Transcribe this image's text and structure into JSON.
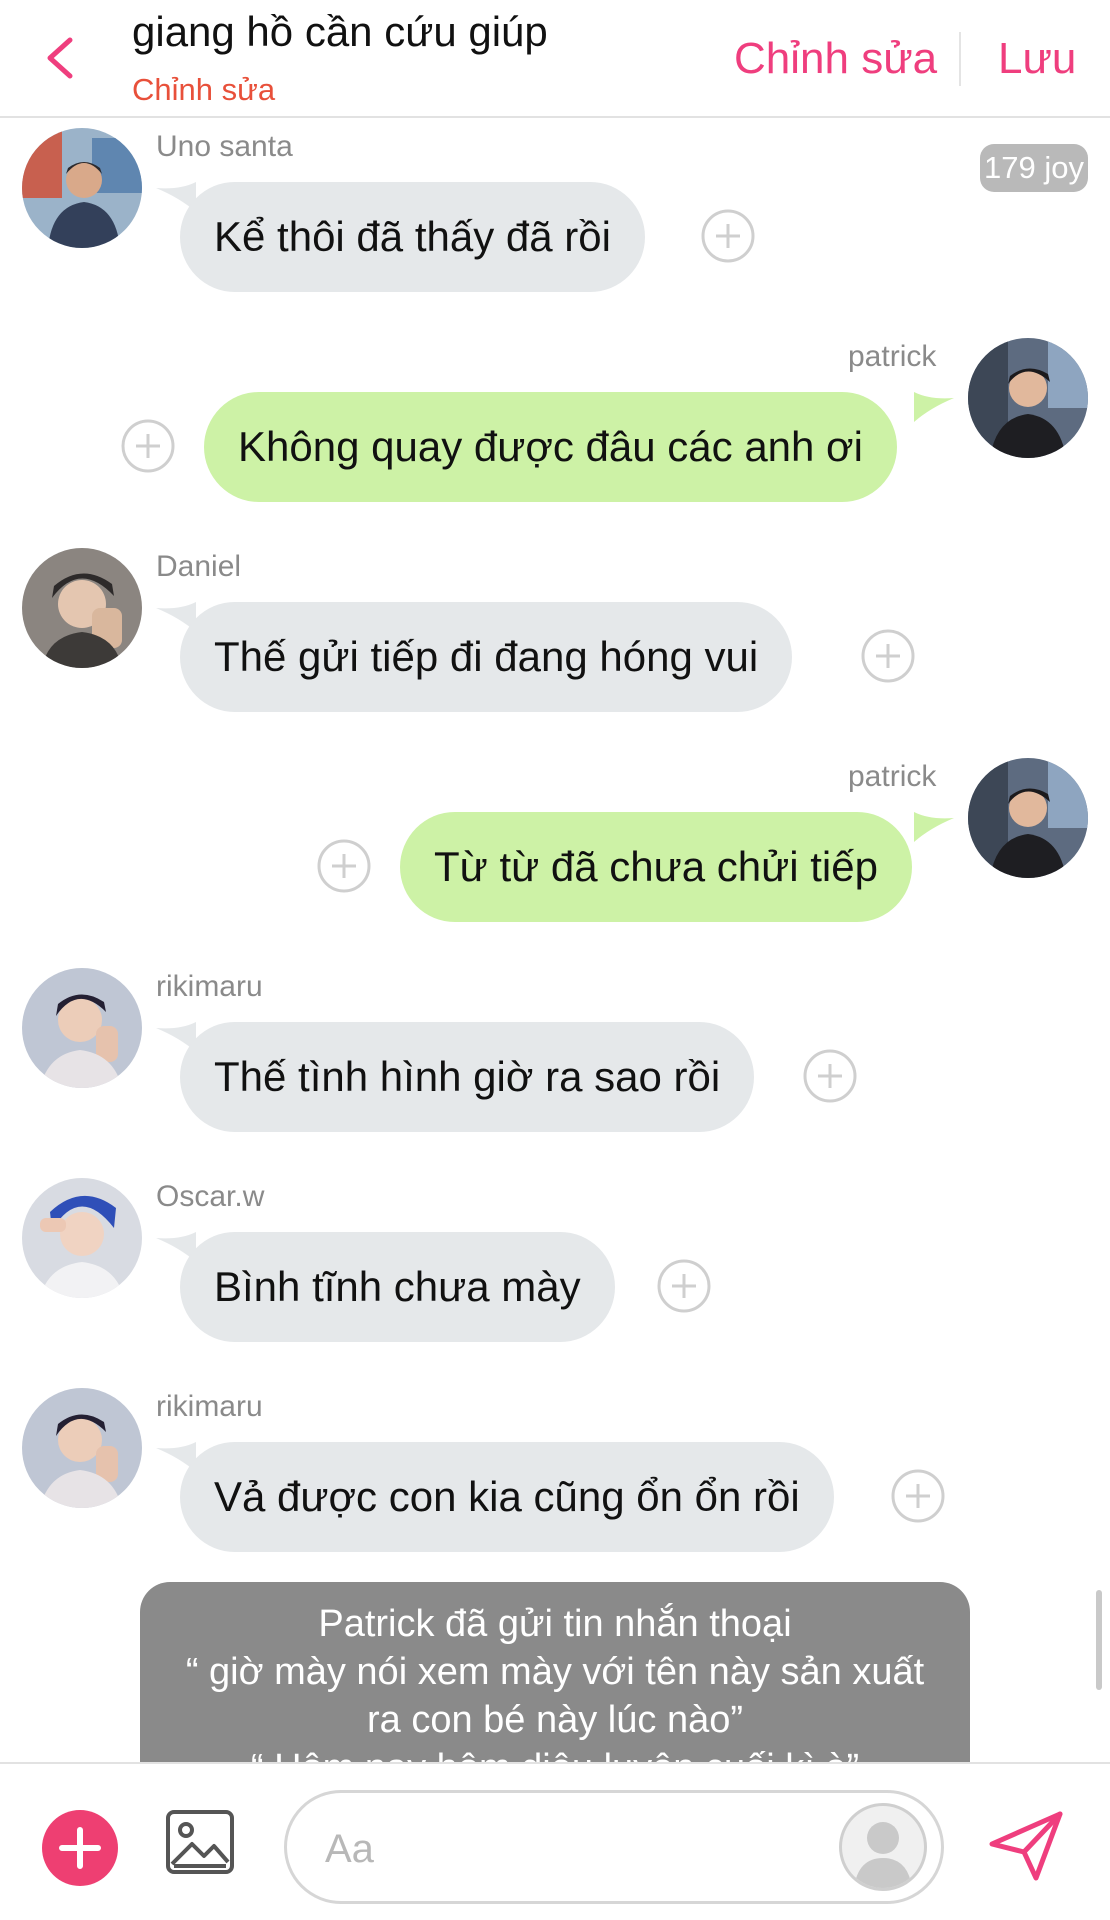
{
  "header": {
    "title": "giang hồ cần cứu giúp",
    "subtitle": "Chỉnh sửa",
    "edit_label": "Chỉnh sửa",
    "save_label": "Lưu"
  },
  "badge": {
    "joy": "179 joy"
  },
  "messages": [
    {
      "sender": "Uno santa",
      "text": "Kể thôi đã thấy đã rồi",
      "side": "left"
    },
    {
      "sender": "patrick",
      "text": "Không quay được đâu các anh ơi",
      "side": "right"
    },
    {
      "sender": "Daniel",
      "text": "Thế gửi tiếp đi đang hóng vui",
      "side": "left"
    },
    {
      "sender": "patrick",
      "text": "Từ từ đã chưa chửi tiếp",
      "side": "right"
    },
    {
      "sender": "rikimaru",
      "text": "Thế tình hình giờ ra sao rồi",
      "side": "left"
    },
    {
      "sender": "Oscar.w",
      "text": "Bình tĩnh chưa mày",
      "side": "left"
    },
    {
      "sender": "rikimaru",
      "text": "Vả được con kia cũng ổn ổn rồi",
      "side": "left"
    }
  ],
  "notice": {
    "line1": "Patrick đã gửi tin nhắn thoại",
    "line2": "“ giờ mày nói xem mày với tên này sản xuất",
    "line3": "ra con bé này lúc nào”",
    "line4": "“ Hôm nay hôm diêu luyện cuối kì à”"
  },
  "composer": {
    "placeholder": "Aa"
  },
  "colors": {
    "accent": "#ef3e7e",
    "subtitle": "#e8503a",
    "left_bubble": "#e5e8ea",
    "right_bubble": "#cdf2a6",
    "notice_bg": "#8a8a8a"
  },
  "icons": {
    "back": "chevron-left-icon",
    "add_reaction": "plus-circle-icon",
    "add": "plus-icon",
    "image": "image-icon",
    "send": "send-icon",
    "profile": "avatar-placeholder-icon"
  }
}
